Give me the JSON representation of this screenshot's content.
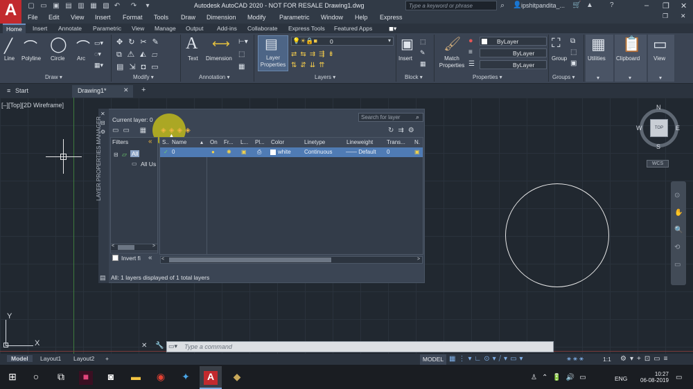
{
  "app": {
    "logo": "A",
    "title": "Autodesk AutoCAD 2020 - NOT FOR RESALE   Drawing1.dwg",
    "search_placeholder": "Type a keyword or phrase",
    "user": "ipshitpandita_..."
  },
  "menu": [
    "File",
    "Edit",
    "View",
    "Insert",
    "Format",
    "Tools",
    "Draw",
    "Dimension",
    "Modify",
    "Parametric",
    "Window",
    "Help",
    "Express"
  ],
  "ribbon_tabs": [
    "Home",
    "Insert",
    "Annotate",
    "Parametric",
    "View",
    "Manage",
    "Output",
    "Add-ins",
    "Collaborate",
    "Express Tools",
    "Featured Apps"
  ],
  "ribbon": {
    "draw": {
      "line": "Line",
      "polyline": "Polyline",
      "circle": "Circle",
      "arc": "Arc",
      "panel": "Draw ▾"
    },
    "modify": {
      "panel": "Modify ▾"
    },
    "annotation": {
      "text": "Text",
      "dimension": "Dimension",
      "panel": "Annotation ▾"
    },
    "layers": {
      "layer_properties": "Layer Properties",
      "current": "0",
      "panel": "Layers ▾"
    },
    "block": {
      "insert": "Insert",
      "panel": "Block ▾"
    },
    "properties": {
      "match": "Match Properties",
      "bylayer1": "ByLayer",
      "bylayer2": "ByLayer",
      "bylayer3": "ByLayer",
      "panel": "Properties ▾"
    },
    "groups": {
      "group": "Group",
      "panel": "Groups ▾"
    },
    "utilities": "Utilities",
    "clipboard": "Clipboard",
    "view": "View"
  },
  "doc_tabs": {
    "start": "Start",
    "drawing": "Drawing1*"
  },
  "viewport_label": "[–][Top][2D Wireframe]",
  "viewcube": {
    "n": "N",
    "s": "S",
    "e": "E",
    "w": "W",
    "top": "TOP",
    "wcs": "WCS"
  },
  "palette": {
    "side_title": "LAYER PROPERTIES MANAGER",
    "current_layer": "Current layer: 0",
    "search": "Search for layer",
    "filters_label": "Filters",
    "collapse": "«",
    "tree_all": "All",
    "tree_used": "All Us",
    "invert": "Invert fi",
    "columns": [
      "S..",
      "Name",
      "On",
      "Fr...",
      "L...",
      "Pl...",
      "Color",
      "Linetype",
      "Lineweight",
      "Trans...",
      "N."
    ],
    "row": {
      "name": "0",
      "color": "white",
      "linetype": "Continuous",
      "lineweight": "—— Default",
      "transparency": "0"
    },
    "status": "All: 1 layers displayed of 1 total layers"
  },
  "axes": {
    "y": "Y",
    "x": "X"
  },
  "command": {
    "placeholder": "Type a command"
  },
  "layout_tabs": [
    "Model",
    "Layout1",
    "Layout2",
    "+"
  ],
  "status_model": "MODEL",
  "status_scale": "1:1",
  "taskbar": {
    "lang": "ENG",
    "time": "10:27",
    "date": "06-08-2019"
  }
}
